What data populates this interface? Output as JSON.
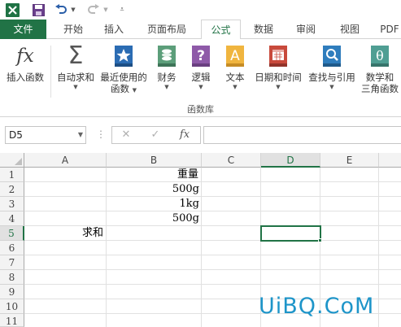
{
  "qat": {
    "icons": [
      "excel-logo-icon",
      "save-icon",
      "undo-icon",
      "redo-icon",
      "customize-icon"
    ]
  },
  "tabs": [
    {
      "label": "文件"
    },
    {
      "label": "开始"
    },
    {
      "label": "插入"
    },
    {
      "label": "页面布局"
    },
    {
      "label": "公式"
    },
    {
      "label": "数据"
    },
    {
      "label": "审阅"
    },
    {
      "label": "视图"
    },
    {
      "label": "PDF"
    }
  ],
  "active_tab": "公式",
  "ribbon": {
    "group_label": "函数库",
    "buttons": [
      {
        "line1": "插入函数",
        "line2": "",
        "has_arrow": false,
        "icon": "fx-icon",
        "glyph": "fx"
      },
      {
        "line1": "自动求和",
        "line2": "",
        "has_arrow": true,
        "icon": "sigma-icon",
        "glyph": "Σ"
      },
      {
        "line1": "最近使用的",
        "line2": "函数",
        "has_arrow": true,
        "icon": "star-book-icon",
        "glyph": "★"
      },
      {
        "line1": "财务",
        "line2": "",
        "has_arrow": true,
        "icon": "coins-book-icon",
        "glyph": "≋"
      },
      {
        "line1": "逻辑",
        "line2": "",
        "has_arrow": true,
        "icon": "question-book-icon",
        "glyph": "?"
      },
      {
        "line1": "文本",
        "line2": "",
        "has_arrow": true,
        "icon": "text-book-icon",
        "glyph": "A"
      },
      {
        "line1": "日期和时间",
        "line2": "",
        "has_arrow": true,
        "icon": "calendar-book-icon",
        "glyph": "▦"
      },
      {
        "line1": "查找与引用",
        "line2": "",
        "has_arrow": true,
        "icon": "magnifier-book-icon",
        "glyph": "⌕"
      },
      {
        "line1": "数学和",
        "line2": "三角函数",
        "has_arrow": true,
        "icon": "theta-book-icon",
        "glyph": "θ"
      }
    ],
    "colors": {
      "star": "#2b6cb3",
      "coins": "#5c9e7a",
      "question": "#8e5aa8",
      "text": "#e2a43a",
      "calendar": "#c84a3c",
      "magnifier": "#2f7dbd",
      "theta": "#4f9e93"
    }
  },
  "formula_bar": {
    "name_box": "D5",
    "cancel_glyph": "✕",
    "enter_glyph": "✓",
    "fx_glyph": "fx",
    "formula": ""
  },
  "grid": {
    "columns": [
      "A",
      "B",
      "C",
      "D",
      "E"
    ],
    "rows": [
      "1",
      "2",
      "3",
      "4",
      "5",
      "6",
      "7",
      "8",
      "9",
      "10",
      "11"
    ],
    "cells": {
      "B1": "重量",
      "B2": "500g",
      "B3": "1kg",
      "B4": "500g",
      "A5": "求和"
    }
  },
  "watermark": "UiBQ.CoM",
  "accent_color": "#217346"
}
